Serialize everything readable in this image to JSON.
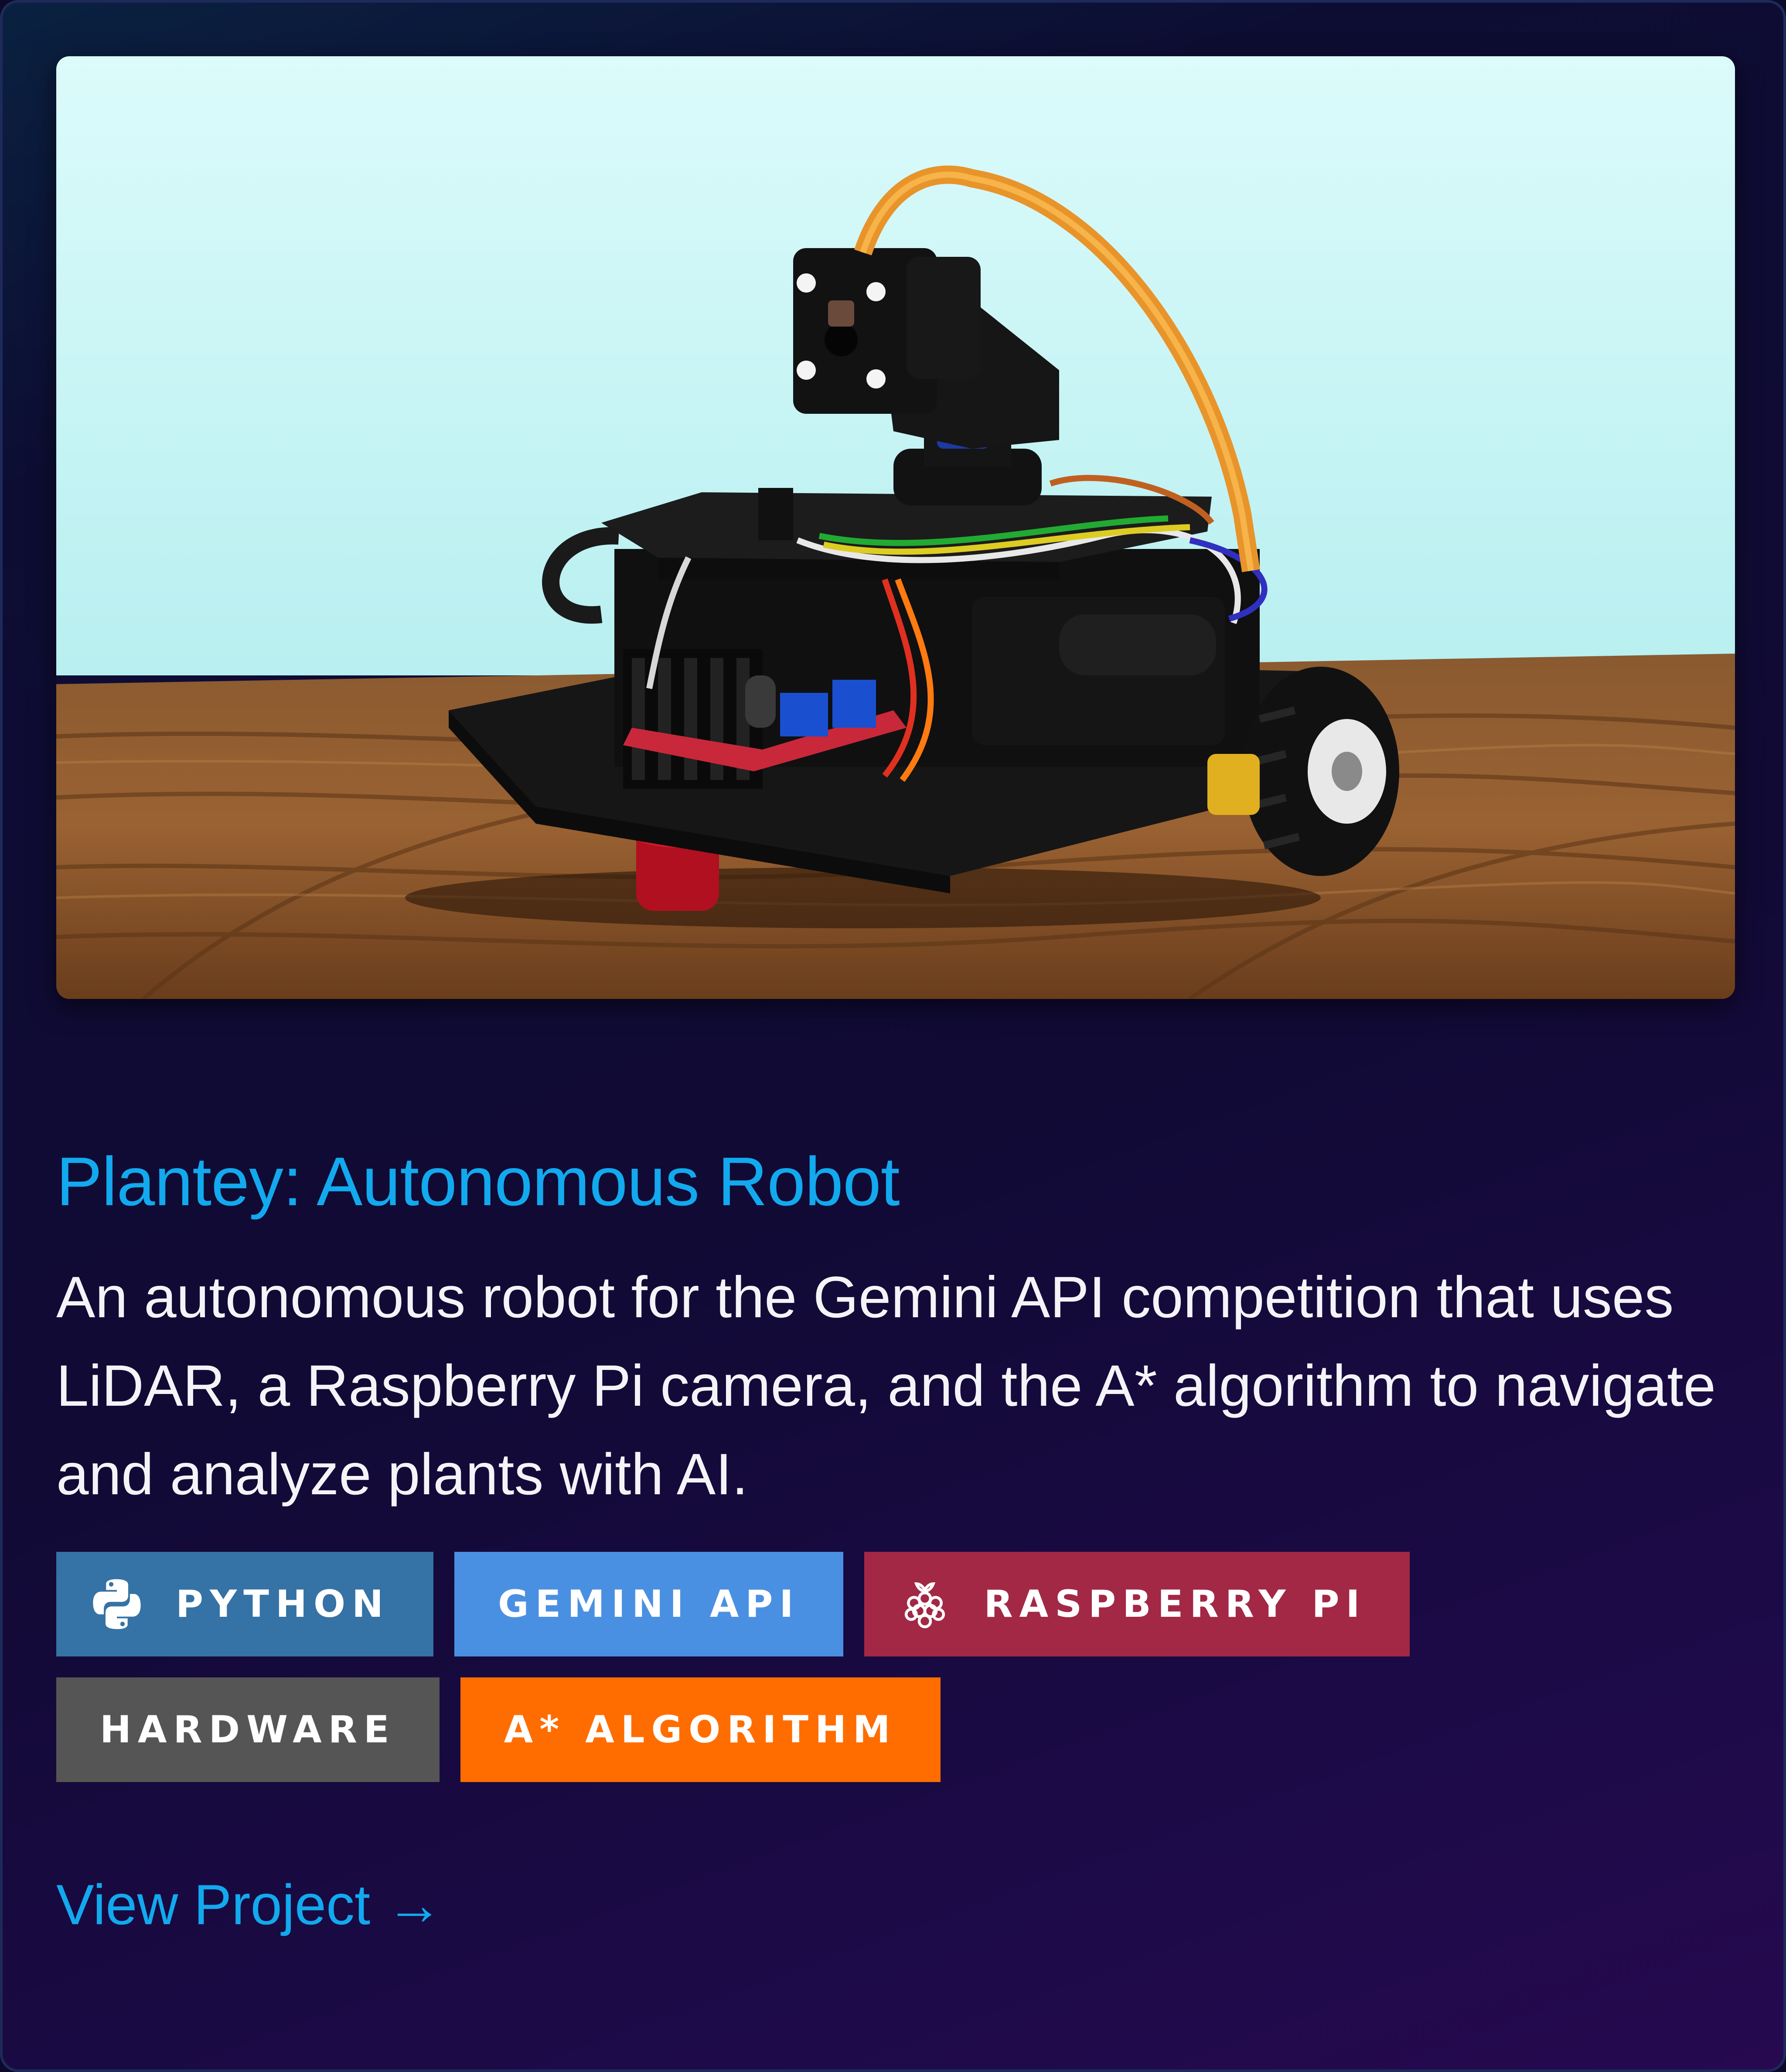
{
  "project": {
    "image_alt": "Plantey autonomous robot with camera, LiDAR and wheels on a wooden table",
    "title": "Plantey: Autonomous Robot",
    "description": "An autonomous robot for the Gemini API competition that uses LiDAR, a Raspberry Pi camera, and the A* algorithm to navigate and analyze plants with AI.",
    "tags": [
      {
        "label": "PYTHON",
        "color": "#3572a5",
        "icon": "python-icon"
      },
      {
        "label": "GEMINI API",
        "color": "#4a90e2",
        "icon": ""
      },
      {
        "label": "RASPBERRY PI",
        "color": "#a22846",
        "icon": "raspberry-pi-icon"
      },
      {
        "label": "HARDWARE",
        "color": "#555555",
        "icon": ""
      },
      {
        "label": "A* ALGORITHM",
        "color": "#ff6d00",
        "icon": ""
      }
    ],
    "link_label": "View Project →"
  },
  "colors": {
    "accent": "#12a9ee",
    "text": "#f4f4f8",
    "background_top": "#0a2140",
    "background_bottom": "#26094f"
  }
}
